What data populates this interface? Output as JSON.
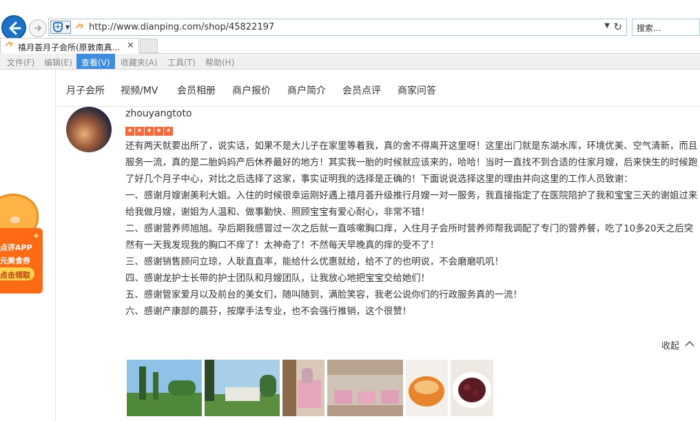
{
  "browser": {
    "url": "http://www.dianping.com/shop/45822197",
    "search_placeholder": "搜索...",
    "tab_title": "禧月荟月子会所(原敦南真...",
    "menu": [
      "文件(F)",
      "编辑(E)",
      "查看(V)",
      "收藏夹(A)",
      "工具(T)",
      "帮助(H)"
    ],
    "active_menu": "查看(V)"
  },
  "shop_nav": [
    "月子会所",
    "视频/MV",
    "会员相册",
    "商户报价",
    "商户简介",
    "会员点评",
    "商家问答"
  ],
  "promo": {
    "line1": "点评APP",
    "line2": "元美食券",
    "button": "点击领取"
  },
  "review": {
    "username": "zhouyangtoto",
    "rating": 5,
    "paragraphs": [
      "还有两天就要出所了，说实话，如果不是大儿子在家里等着我，真的舍不得离开这里呀！这里出门就是东湖水库，环境优美、空气清新，而且服务一流，真的是二胎妈妈产后休养最好的地方！其实我一胎的时候就应该来的，哈哈！当时一直找不到合适的住家月嫂，后来快生的时候跑了好几个月子中心，对比之后选择了这家，事实证明我的选择是正确的！下面说说选择这里的理由并向这里的工作人员致谢：",
      "一、感谢月嫂谢美利大姐。入住的时候很幸运刚好遇上禧月荟升级推行月嫂一对一服务，我直接指定了在医院陪护了我和宝宝三天的谢姐过来给我做月嫂，谢姐为人温和、做事勤快、照顾宝宝有爱心耐心，非常不错！",
      "二、感谢营养师旭旭。孕后期我感冒过一次之后就一直咳嗽胸口痒，入住月子会所时营养师帮我调配了专门的营养餐，吃了10多20天之后突然有一天我发现我的胸口不痒了！太神奇了！不然每天早晚真的痒的受不了！",
      "三、感谢销售顾问立琼，人耿直直率，能给什么优惠就给，给不了的也明说，不会磨磨叽叽！",
      "四、感谢龙护士长带的护士团队和月嫂团队，让我放心地把宝宝交给她们！",
      "五、感谢管家爱月以及前台的美女们，随叫随到，满脸笑容，我老公说你们的行政服务真的一流！",
      "六、感谢产康部的晨芬，按摩手法专业，也不会强行推销，这个很赞！"
    ],
    "collapse_label": "收起"
  }
}
